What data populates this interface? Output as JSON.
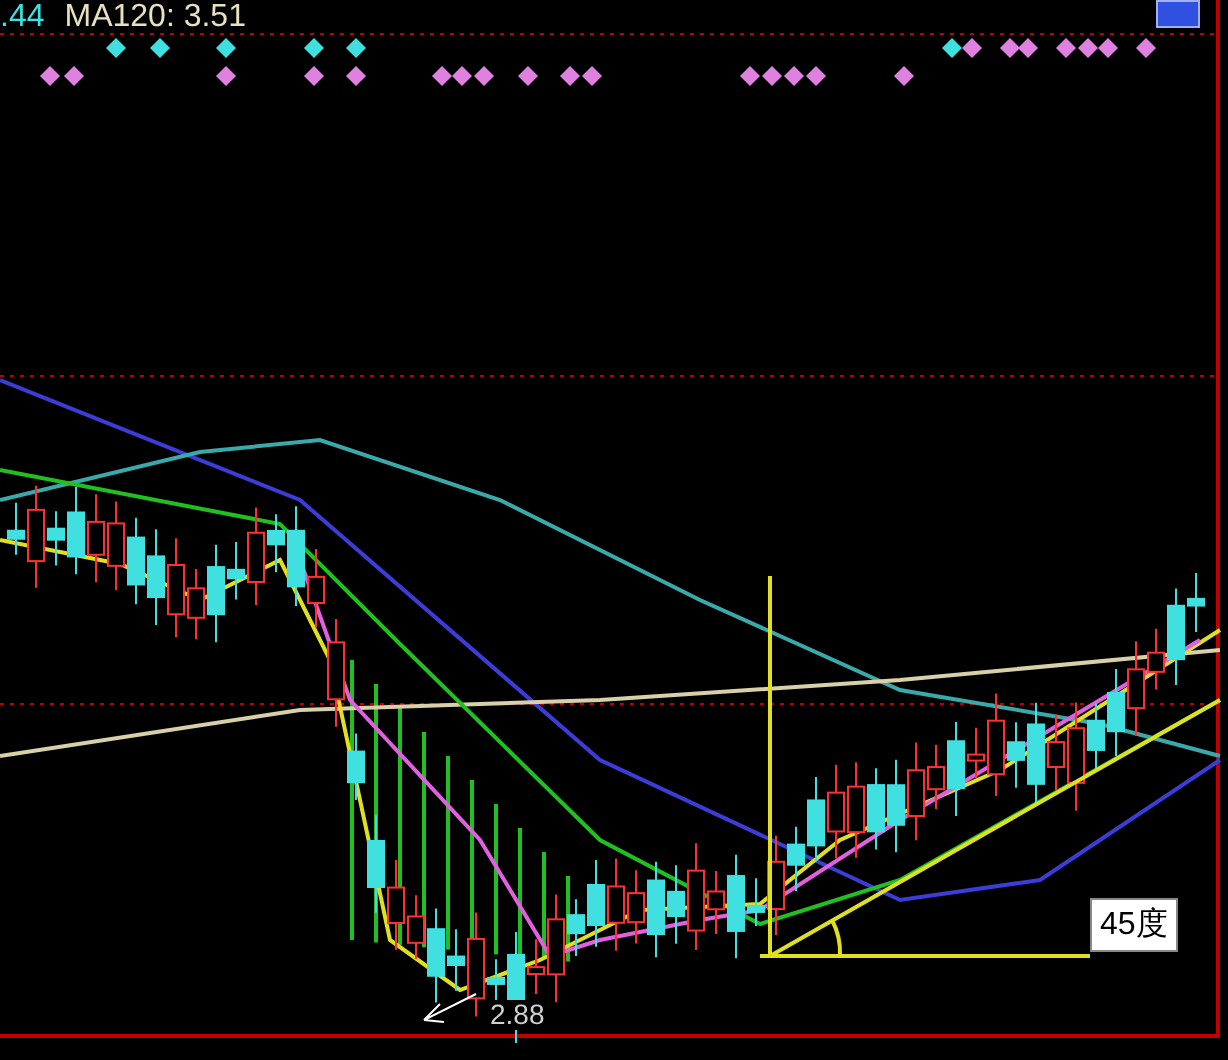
{
  "header": {
    "ma_value": ".44",
    "ma_label": "MA120: 3.51"
  },
  "chart": {
    "low_label": "2.88",
    "angle_label": "45度"
  }
}
